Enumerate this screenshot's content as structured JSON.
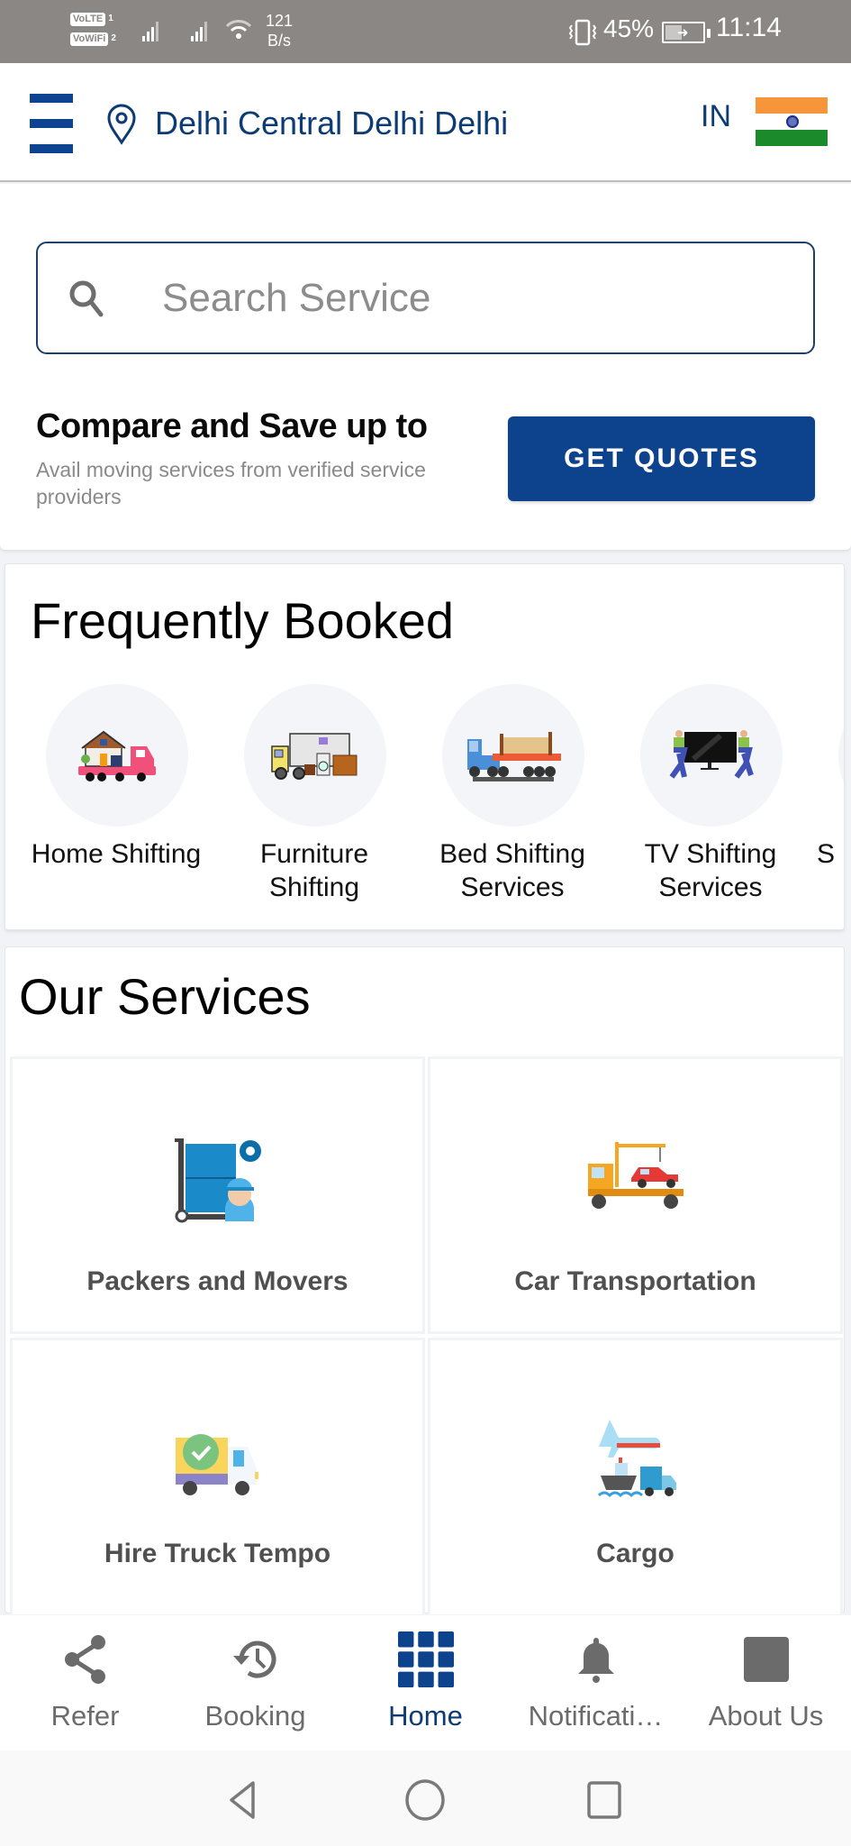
{
  "status_bar": {
    "sim1_badge": "VoLTE",
    "sim1_num": "1",
    "sim2_badge": "VoWiFi",
    "sim2_num": "2",
    "net_speed_value": "121",
    "net_speed_unit": "B/s",
    "battery_percent": "45%",
    "battery_level": 0.45,
    "time": "11:14"
  },
  "header": {
    "location": "Delhi Central Delhi Delhi",
    "country_code": "IN",
    "flag": "india-flag"
  },
  "search": {
    "placeholder": "Search Service",
    "value": ""
  },
  "promo": {
    "title": "Compare and Save up to",
    "subtitle": "Avail moving services from verified service providers",
    "button_label": "GET QUOTES"
  },
  "frequently_booked": {
    "title": "Frequently Booked",
    "items": [
      {
        "label": "Home Shifting",
        "icon": "home-shifting-truck-icon"
      },
      {
        "label": "Furniture Shifting",
        "icon": "furniture-truck-icon"
      },
      {
        "label": "Bed Shifting Services",
        "icon": "bed-truck-icon"
      },
      {
        "label": "TV Shifting Services",
        "icon": "tv-movers-icon"
      },
      {
        "label": "S",
        "icon": "partial-item"
      }
    ]
  },
  "our_services": {
    "title": "Our Services",
    "items": [
      {
        "label": "Packers and Movers",
        "icon": "packers-movers-icon"
      },
      {
        "label": "Car Transportation",
        "icon": "car-tow-truck-icon"
      },
      {
        "label": "Hire Truck Tempo",
        "icon": "delivery-truck-check-icon"
      },
      {
        "label": "Cargo",
        "icon": "cargo-plane-ship-truck-icon"
      }
    ]
  },
  "bottom_nav": {
    "items": [
      {
        "label": "Refer",
        "icon": "share-icon",
        "active": false
      },
      {
        "label": "Booking",
        "icon": "history-icon",
        "active": false
      },
      {
        "label": "Home",
        "icon": "grid-icon",
        "active": true
      },
      {
        "label": "Notificati…",
        "icon": "bell-icon",
        "active": false
      },
      {
        "label": "About Us",
        "icon": "about-square-icon",
        "active": false
      }
    ]
  },
  "colors": {
    "brand_blue": "#0d428c",
    "text_blue": "#0d3b74",
    "nav_inactive": "#6b6b6b",
    "status_bar": "#8a8784"
  }
}
